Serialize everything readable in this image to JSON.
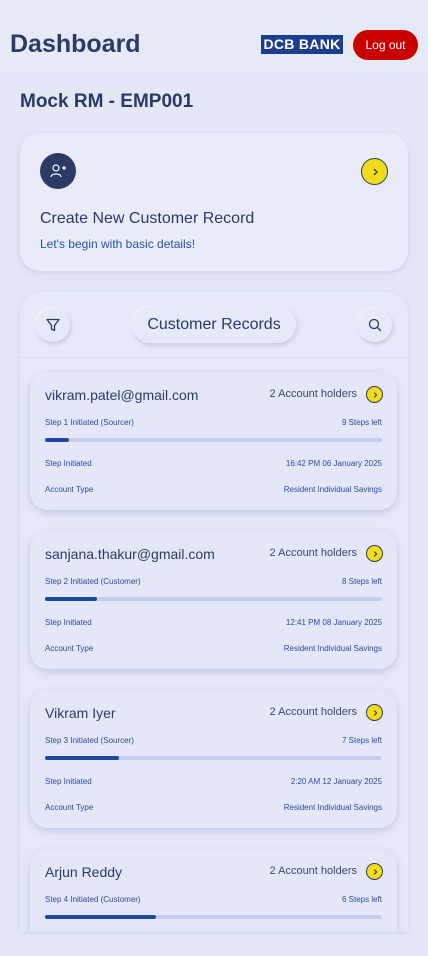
{
  "header": {
    "title": "Dashboard",
    "bank_logo": "DCB BANK",
    "logout_label": "Log out"
  },
  "rm_name": "Mock RM - EMP001",
  "create_card": {
    "icon": "add-user-icon",
    "title": "Create New Customer Record",
    "subtitle": "Let's begin with basic details!"
  },
  "records": {
    "title": "Customer Records",
    "filter_icon": "filter-icon",
    "search_icon": "search-icon",
    "items": [
      {
        "name": "vikram.patel@gmail.com",
        "holders": "2 Account holders",
        "step": "Step 1 Initiated (Sourcer)",
        "steps_left": "9 Steps left",
        "progress": 0.07,
        "initiated_label": "Step Initiated",
        "initiated_time": "16:42 PM 06 January 2025",
        "account_type_label": "Account Type",
        "account_type": "Resident Individual Savings"
      },
      {
        "name": "sanjana.thakur@gmail.com",
        "holders": "2 Account holders",
        "step": "Step 2 Initiated (Customer)",
        "steps_left": "8 Steps left",
        "progress": 0.155,
        "initiated_label": "Step Initiated",
        "initiated_time": "12:41 PM 08 January 2025",
        "account_type_label": "Account Type",
        "account_type": "Resident Individual Savings"
      },
      {
        "name": "Vikram Iyer",
        "holders": "2 Account holders",
        "step": "Step 3 Initiated (Sourcer)",
        "steps_left": "7 Steps left",
        "progress": 0.22,
        "initiated_label": "Step Initiated",
        "initiated_time": "2:20 AM 12 January 2025",
        "account_type_label": "Account Type",
        "account_type": "Resident Individual Savings"
      },
      {
        "name": "Arjun Reddy",
        "holders": "2 Account holders",
        "step": "Step 4 Initiated (Customer)",
        "steps_left": "6 Steps left",
        "progress": 0.33
      }
    ]
  },
  "colors": {
    "background": "#e3e7f6",
    "primary_text": "#2b3a67",
    "accent_yellow": "#f2dc19",
    "logout_red": "#c80000",
    "brand_blue": "#1d3e8c",
    "progress_fill": "#1d4a9e"
  }
}
